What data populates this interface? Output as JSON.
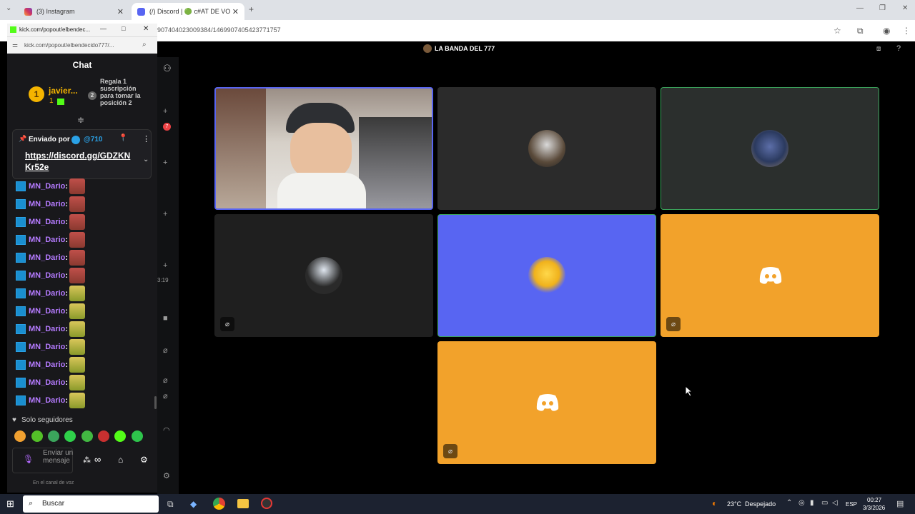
{
  "browser": {
    "tabs": [
      {
        "title": "(3) Instagram"
      },
      {
        "title": "(/) Discord | 🟢 c#AT DE VO"
      }
    ],
    "url": "907404023009384/1469907405423771757"
  },
  "discord": {
    "channel_title": "LA BANDA DEL 777",
    "side_badge": "7",
    "time_fragment": "3:19"
  },
  "popout": {
    "window_title": "kick.com/popout/elbendec...",
    "address": "kick.com/popout/elbendecido777/...",
    "chat_title": "Chat",
    "top_gifter": {
      "rank": "1",
      "name": "javier...",
      "count": "1",
      "position_rank": "2",
      "gift_prompt": "Regala 1 suscripción para tomar la posición 2"
    },
    "pinned": {
      "sent_by_label": "Enviado por",
      "sender": "@710",
      "link": "https://discord.gg/GDZKN Kr52e"
    },
    "messages": [
      {
        "user": "MN_Dario",
        "sep": ":"
      },
      {
        "user": "MN_Dario",
        "sep": ":"
      },
      {
        "user": "MN_Dario",
        "sep": ":"
      },
      {
        "user": "MN_Dario",
        "sep": ":"
      },
      {
        "user": "MN_Dario",
        "sep": ":"
      },
      {
        "user": "MN_Dario",
        "sep": ":"
      },
      {
        "user": "MN_Dario",
        "sep": ":"
      },
      {
        "user": "MN_Dario",
        "sep": ":"
      },
      {
        "user": "MN_Dario",
        "sep": ":"
      },
      {
        "user": "MN_Dario",
        "sep": ":"
      },
      {
        "user": "MN_Dario",
        "sep": ":"
      },
      {
        "user": "MN_Dario",
        "sep": ":"
      },
      {
        "user": "MN_Dario",
        "sep": ":"
      }
    ],
    "followers_only": "Solo seguidores",
    "send_placeholder": "Enviar un mensaje",
    "voice_status": "En el canal de voz"
  },
  "taskbar": {
    "search_label": "Buscar",
    "weather": "23°C  Despejado",
    "language": "ESP",
    "time": "00:27",
    "date": "3/3/2026"
  },
  "colors": {
    "discord_blurple": "#5865f2",
    "discord_orange": "#f2a22b",
    "kick_green": "#53fc18",
    "username_purple": "#b57bff"
  }
}
